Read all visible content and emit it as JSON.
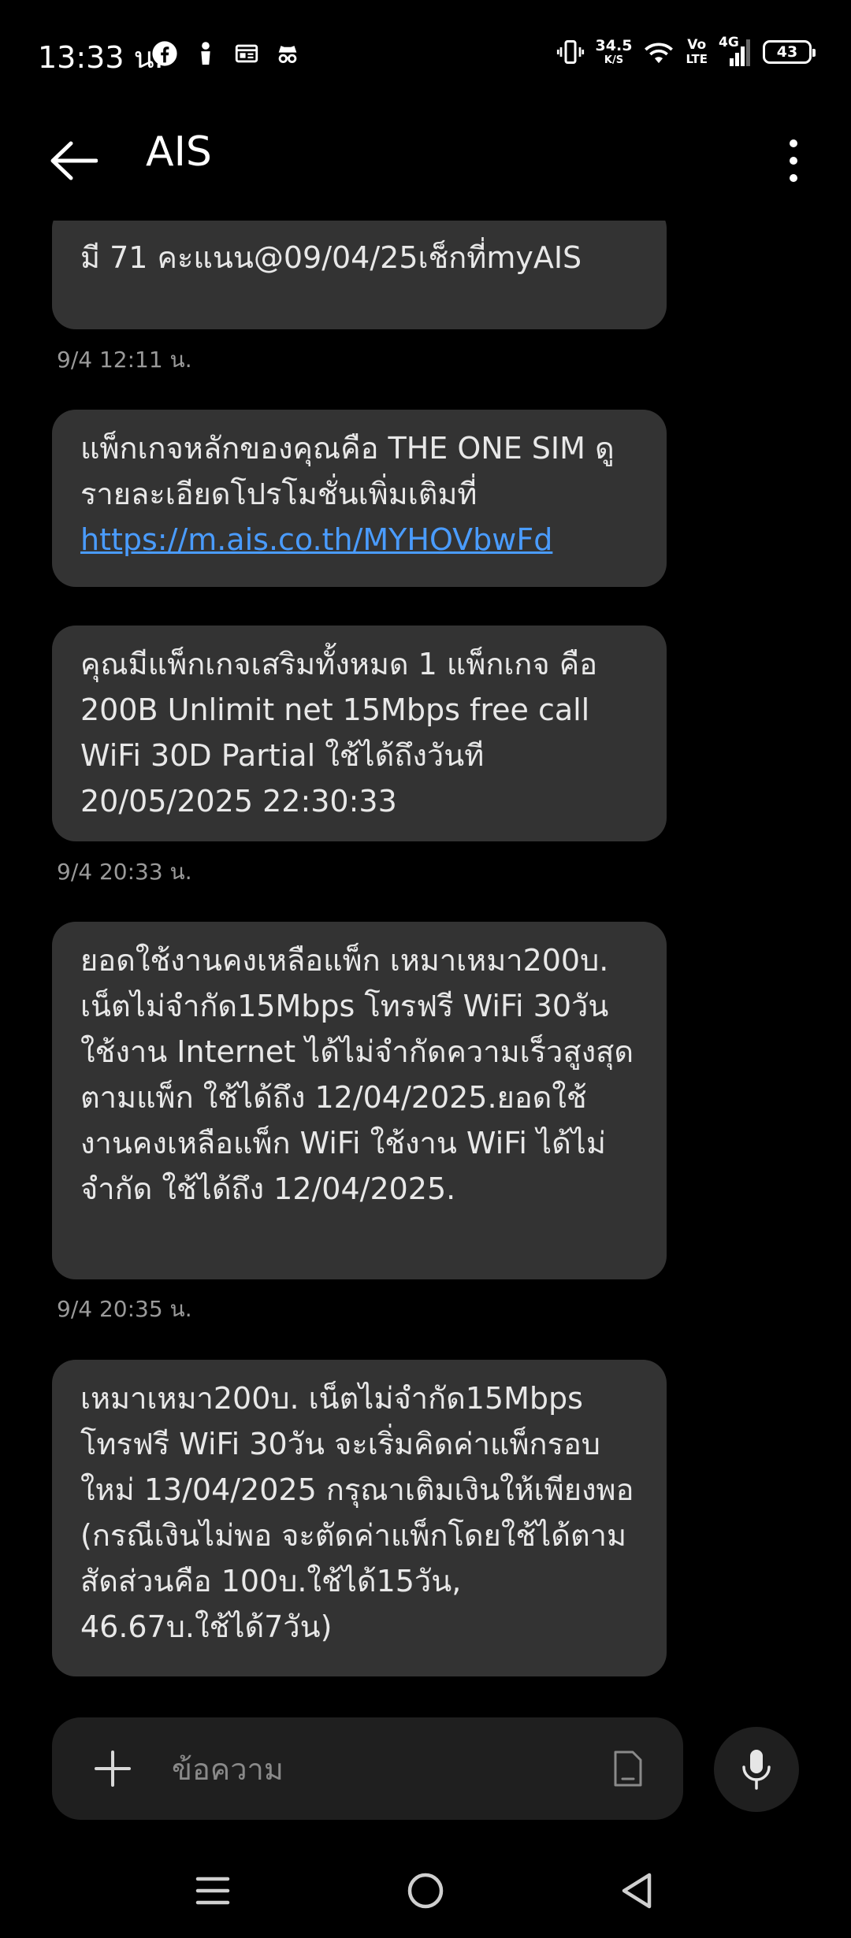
{
  "status_bar": {
    "time": "13:33 น.",
    "net_speed_value": "34.5",
    "net_speed_unit": "K/S",
    "volte_top": "Vo",
    "volte_bottom": "LTE",
    "network_type": "4G",
    "battery": "43",
    "left_icons": [
      "facebook-icon",
      "person-icon",
      "news-icon",
      "incognito-icon"
    ],
    "right_icons": [
      "vibrate-icon",
      "wifi-icon",
      "signal-icon",
      "battery-icon"
    ]
  },
  "app_bar": {
    "title": "AIS"
  },
  "messages": [
    {
      "text": "มี 71 คะแนน@09/04/25เช็กที่myAIS",
      "timestamp": "9/4 12:11 น."
    },
    {
      "text_before": "แพ็กเกจหลักของคุณคือ THE ONE SIM ดูรายละเอียดโปรโมชั่นเพิ่มเติมที่",
      "link": "https://m.ais.co.th/MYHOVbwFd"
    },
    {
      "text": "คุณมีแพ็กเกจเสริมทั้งหมด 1 แพ็กเกจ คือ 200B Unlimit net 15Mbps free call WiFi 30D Partial ใช้ได้ถึงวันที 20/05/2025 22:30:33",
      "timestamp": "9/4 20:33 น."
    },
    {
      "text": "ยอดใช้งานคงเหลือแพ็ก เหมาเหมา200บ. เน็ตไม่จำกัด15Mbps โทรฟรี WiFi 30วัน ใช้งาน Internet ได้ไม่จำกัดความเร็วสูงสุดตามแพ็ก ใช้ได้ถึง 12/04/2025.ยอดใช้งานคงเหลือแพ็ก WiFi ใช้งาน WiFi ได้ไม่จำกัด ใช้ได้ถึง 12/04/2025.",
      "timestamp": "9/4 20:35 น."
    },
    {
      "text": "เหมาเหมา200บ. เน็ตไม่จำกัด15Mbps โทรฟรี WiFi 30วัน จะเริ่มคิดค่าแพ็กรอบใหม่ 13/04/2025 กรุณาเติมเงินให้เพียงพอ (กรณีเงินไม่พอ จะตัดค่าแพ็กโดยใช้ได้ตามสัดส่วนคือ 100บ.ใช้ได้15วัน, 46.67บ.ใช้ได้7วัน)"
    }
  ],
  "composer": {
    "placeholder": "ข้อความ"
  },
  "colors": {
    "background": "#000000",
    "bubble": "#333333",
    "link": "#4a9cff",
    "timestamp": "#9a9a9a",
    "composer": "#1f1f1f"
  }
}
